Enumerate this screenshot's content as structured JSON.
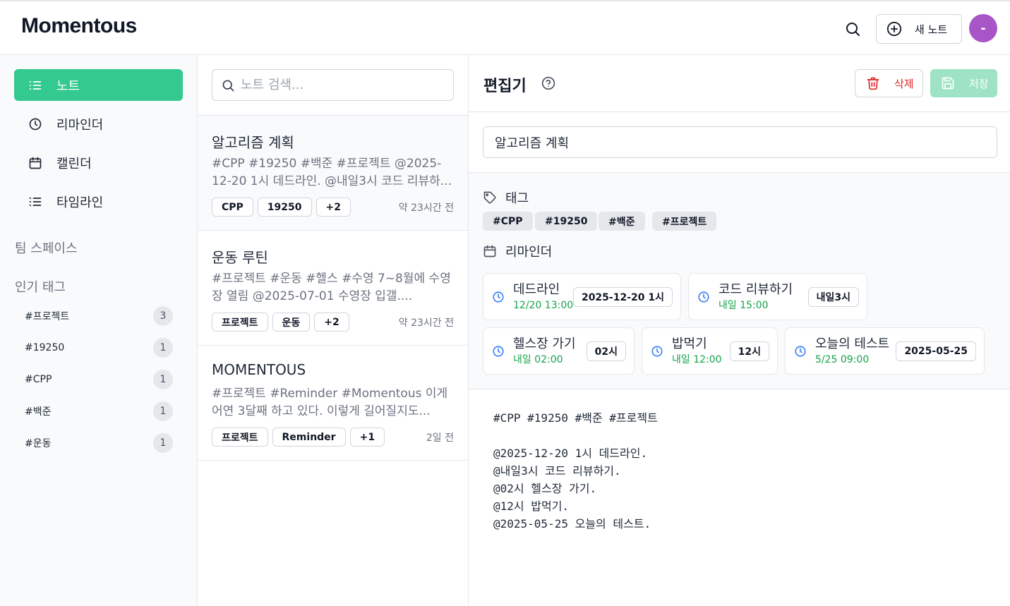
{
  "app": {
    "logo": "Momentous"
  },
  "header": {
    "new_note_label": "새 노트",
    "avatar_initial": "-",
    "avatar_color": "#a855c7"
  },
  "sidebar": {
    "nav": [
      {
        "label": "노트",
        "icon": "list-icon",
        "active": true
      },
      {
        "label": "리마인더",
        "icon": "clock-icon",
        "active": false
      },
      {
        "label": "캘린더",
        "icon": "calendar-icon",
        "active": false
      },
      {
        "label": "타임라인",
        "icon": "list-icon",
        "active": false
      }
    ],
    "team_space_label": "팀 스페이스",
    "popular_tags_label": "인기 태그",
    "tags": [
      {
        "name": "#프로젝트",
        "count": "3"
      },
      {
        "name": "#19250",
        "count": "1"
      },
      {
        "name": "#CPP",
        "count": "1"
      },
      {
        "name": "#백준",
        "count": "1"
      },
      {
        "name": "#운동",
        "count": "1"
      }
    ]
  },
  "notes": {
    "search_placeholder": "노트 검색...",
    "items": [
      {
        "title": "알고리즘 계획",
        "snippet": "#CPP #19250 #백준 #프로젝트 @2025-12-20 1시 데드라인. @내일3시 코드 리뷰하...",
        "chips": [
          "CPP",
          "19250",
          "+2"
        ],
        "time": "약 23시간 전",
        "selected": true
      },
      {
        "title": "운동 루틴",
        "snippet": "#프로젝트 #운동 #헬스 #수영 7~8월에 수영장 열림 @2025-07-01 수영장 입갤....",
        "chips": [
          "프로젝트",
          "운동",
          "+2"
        ],
        "time": "약 23시간 전",
        "selected": false
      },
      {
        "title": "MOMENTOUS",
        "snippet": "#프로젝트 #Reminder #Momentous 이게 어연 3달째 하고 있다. 이렇게 길어질지도...",
        "chips": [
          "프로젝트",
          "Reminder",
          "+1"
        ],
        "time": "2일 전",
        "selected": false
      }
    ]
  },
  "editor": {
    "heading": "편집기",
    "delete_label": "삭제",
    "save_label": "저장",
    "title_value": "알고리즘 계획",
    "tags_label": "태그",
    "tags": [
      "#CPP",
      "#19250",
      "#백준",
      "#프로젝트"
    ],
    "reminders_label": "리마인더",
    "reminders": [
      {
        "name": "데드라인",
        "date": "12/20 13:00",
        "badge": "2025-12-20 1시"
      },
      {
        "name": "코드 리뷰하기",
        "date": "내일 15:00",
        "badge": "내일3시"
      },
      {
        "name": "헬스장 가기",
        "date": "내일 02:00",
        "badge": "02시"
      },
      {
        "name": "밥먹기",
        "date": "내일 12:00",
        "badge": "12시"
      },
      {
        "name": "오늘의 테스트",
        "date": "5/25 09:00",
        "badge": "2025-05-25"
      }
    ],
    "content": "#CPP #19250 #백준 #프로젝트\n\n@2025-12-20 1시 데드라인.\n@내일3시 코드 리뷰하기.\n@02시 헬스장 가기.\n@12시 밥먹기.\n@2025-05-25 오늘의 테스트."
  },
  "colors": {
    "accent": "#34c98e",
    "danger": "#dc2626",
    "reminder_date": "#16a34a",
    "save_disabled": "#9ee3c5"
  }
}
